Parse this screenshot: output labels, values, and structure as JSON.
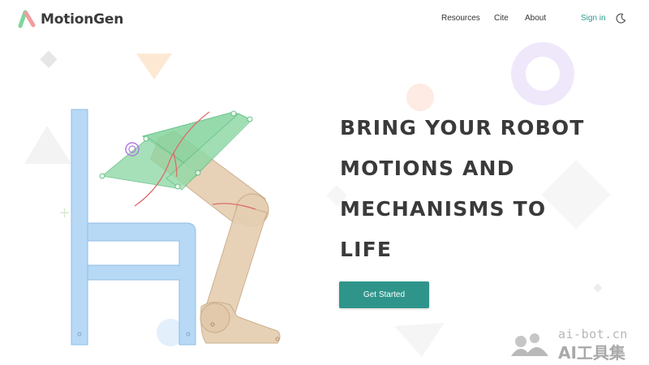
{
  "brand": {
    "name": "MotionGen",
    "logo_icon": "motiongen-logo-icon"
  },
  "nav": {
    "links": [
      "Resources",
      "Cite",
      "About"
    ],
    "signin_label": "Sign in",
    "theme_icon": "moon-icon"
  },
  "hero": {
    "title_lines": [
      "BRING YOUR ROBOT",
      "MOTIONS AND",
      "MECHANISMS TO",
      "LIFE"
    ],
    "cta_label": "Get Started"
  },
  "watermark": {
    "domain": "ai-bot.cn",
    "brand": "AI工具集"
  },
  "colors": {
    "accent": "#2f958b",
    "signin": "#2f9a8e",
    "chair": "#b7d9f5",
    "leg": "#e5cfb3",
    "linkage": "#84d49e",
    "curve": "#e06a6a"
  }
}
